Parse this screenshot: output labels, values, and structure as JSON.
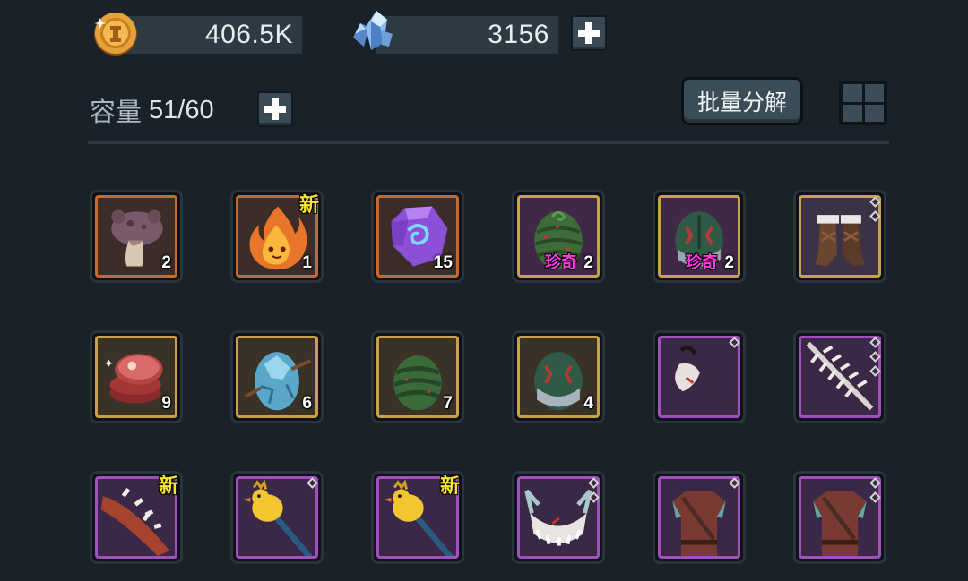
{
  "currency": {
    "coins": "406.5K",
    "gems": "3156",
    "coin_icon": "gold-coin-icon",
    "gem_icon": "blue-crystal-icon"
  },
  "inventory_header": {
    "capacity_label": "容量",
    "capacity_value": "51/60",
    "batch_button_label": "批量分解",
    "view_toggle_icon": "grid-view-icon"
  },
  "colors": {
    "background": "#1a2128",
    "rarity_orange": "#c76a2c",
    "rarity_gold": "#c9a04b",
    "rarity_purple": "#a24fc0",
    "new_badge": "#f6e436",
    "rare_tag": "#ff3ae6"
  },
  "items": [
    {
      "icon": "mushroom-icon",
      "qty": "2"
    },
    {
      "icon": "fire-spirit-icon",
      "qty": "1",
      "badge": "新"
    },
    {
      "icon": "purple-rune-stone-icon",
      "qty": "15"
    },
    {
      "icon": "vine-egg-icon",
      "qty": "2",
      "tag": "珍奇"
    },
    {
      "icon": "dragon-egg-icon",
      "qty": "2",
      "tag": "珍奇"
    },
    {
      "icon": "leather-boots-icon"
    },
    {
      "icon": "raw-meat-icon",
      "qty": "9"
    },
    {
      "icon": "ice-egg-icon",
      "qty": "6"
    },
    {
      "icon": "pine-egg-icon",
      "qty": "7"
    },
    {
      "icon": "scaled-egg-icon",
      "qty": "4"
    },
    {
      "icon": "bone-axe-icon"
    },
    {
      "icon": "spiked-sword-icon"
    },
    {
      "icon": "spiked-club-icon",
      "badge": "新"
    },
    {
      "icon": "duck-scepter-icon"
    },
    {
      "icon": "duck-scepter-icon",
      "badge": "新"
    },
    {
      "icon": "bone-helmet-icon"
    },
    {
      "icon": "leather-armor-icon"
    },
    {
      "icon": "leather-armor-icon"
    }
  ]
}
